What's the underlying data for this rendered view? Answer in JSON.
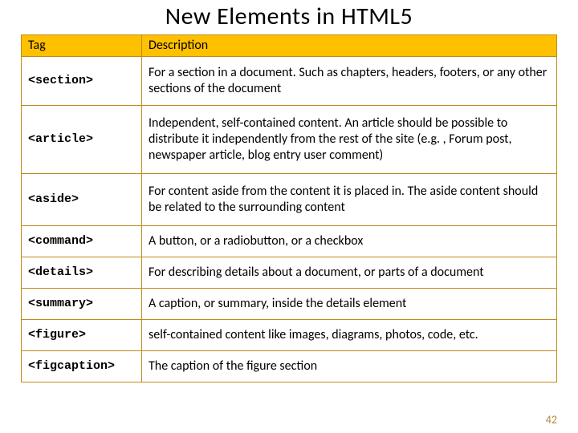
{
  "title": "New Elements in HTML5",
  "headers": {
    "tag": "Tag",
    "desc": "Description"
  },
  "rows": [
    {
      "tag": "<section>",
      "desc": "For a section in a document. Such as chapters, headers, footers, or any other sections of the document"
    },
    {
      "tag": "<article>",
      "desc": "Independent, self-contained content. An article should be possible to distribute it independently from the rest of the site (e.g. , Forum post, newspaper article, blog entry user comment)"
    },
    {
      "tag": "<aside>",
      "desc": "For content aside from the content it is placed in. The aside content should be related to the surrounding content"
    },
    {
      "tag": "<command>",
      "desc": "A button, or a radiobutton, or a checkbox"
    },
    {
      "tag": "<details>",
      "desc": "For describing details about a document, or parts of a document"
    },
    {
      "tag": "<summary>",
      "desc": "A caption, or summary, inside the details element"
    },
    {
      "tag": "<figure>",
      "desc": "self-contained content  like images, diagrams, photos, code, etc."
    },
    {
      "tag": "<figcaption>",
      "desc": "The caption of the figure section"
    }
  ],
  "page_number": "42"
}
